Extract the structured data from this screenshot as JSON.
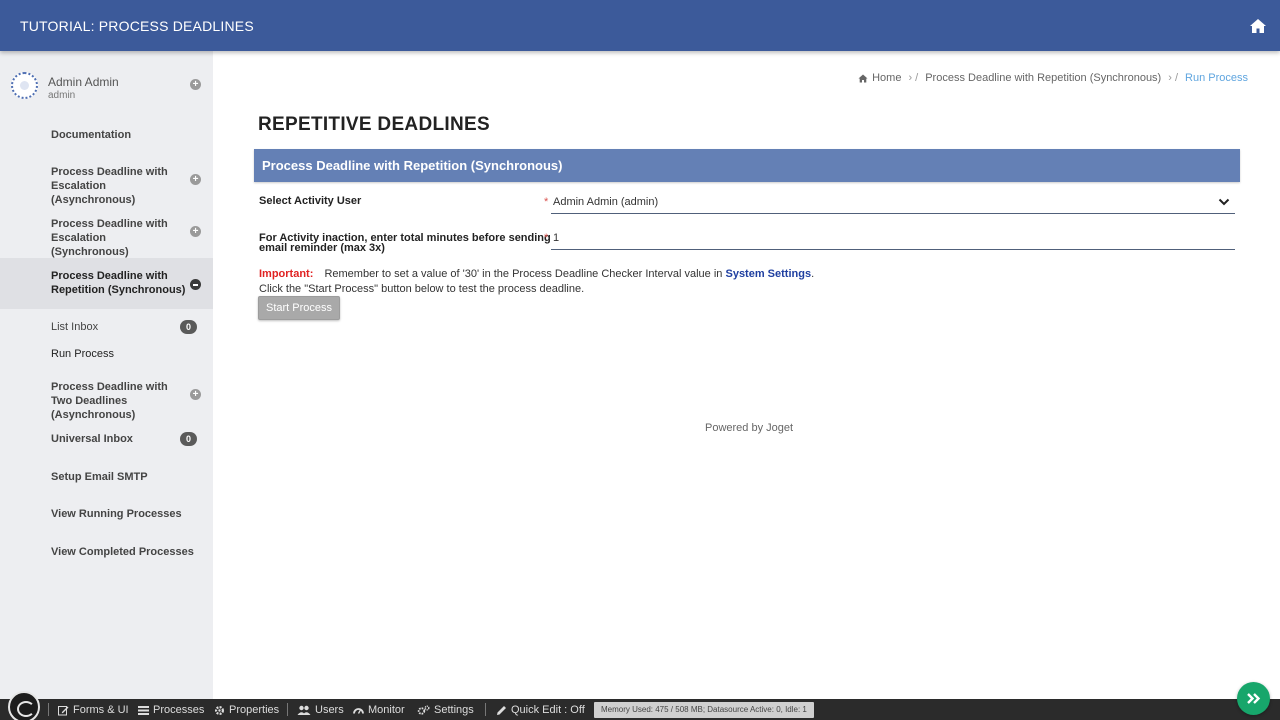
{
  "header": {
    "app_title": "TUTORIAL: PROCESS DEADLINES"
  },
  "user": {
    "name": "Admin Admin",
    "login": "admin"
  },
  "sidebar": {
    "items": [
      {
        "label": "Documentation"
      },
      {
        "label": "Process Deadline with Escalation (Asynchronous)"
      },
      {
        "label": "Process Deadline with Escalation (Synchronous)"
      },
      {
        "label": "Process Deadline with Repetition (Synchronous)"
      },
      {
        "label": "List Inbox",
        "badge": "0"
      },
      {
        "label": "Run Process"
      },
      {
        "label": "Process Deadline with Two Deadlines (Asynchronous)"
      },
      {
        "label": "Universal Inbox",
        "badge": "0"
      },
      {
        "label": "Setup Email SMTP"
      },
      {
        "label": "View Running Processes"
      },
      {
        "label": "View Completed Processes"
      }
    ]
  },
  "breadcrumb": {
    "home": "Home",
    "parent": "Process Deadline with Repetition (Synchronous)",
    "current": "Run Process"
  },
  "page": {
    "title": "REPETITIVE DEADLINES"
  },
  "form": {
    "header": "Process Deadline with Repetition (Synchronous)",
    "fields": {
      "activity_user": {
        "label": "Select Activity User",
        "value": "Admin Admin (admin)"
      },
      "minutes": {
        "label_line1": "For Activity inaction, enter total minutes before sending",
        "label_line2": "email reminder (max 3x)",
        "value": "1"
      }
    },
    "important_label": "Important:",
    "important_text": "Remember to set a value of '30' in the Process Deadline Checker Interval value in",
    "system_settings_link": "System Settings",
    "important_end": ".",
    "hint": "Click the \"Start Process\" button below to test the process deadline.",
    "start_button": "Start Process"
  },
  "footer": {
    "powered_by": "Powered by Joget"
  },
  "adminbar": {
    "forms_ui": "Forms & UI",
    "processes": "Processes",
    "properties": "Properties",
    "users": "Users",
    "monitor": "Monitor",
    "settings": "Settings",
    "quick_edit": "Quick Edit : Off",
    "status": "Memory Used: 475 / 508 MB; Datasource Active: 0, Idle: 1"
  },
  "colors": {
    "header_bg": "#3c5a9a",
    "form_header_bg": "#6480b5",
    "sidebar_bg": "#edeef1",
    "link_blue": "#5fa5df",
    "important_red": "#e02222",
    "expand_green": "#17a66b"
  }
}
